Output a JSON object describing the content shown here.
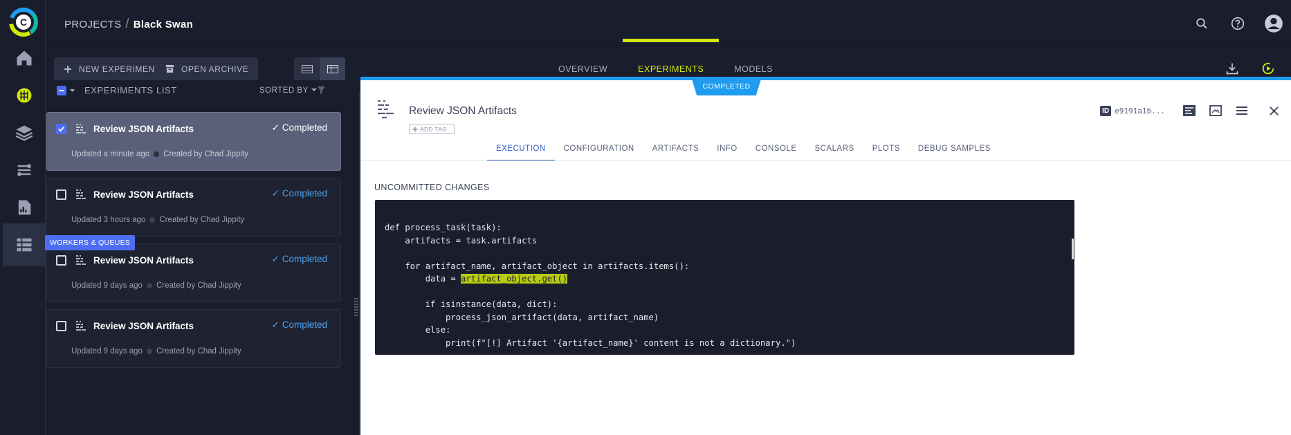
{
  "app": {
    "logo_letter": "C"
  },
  "nav": {
    "items": [
      {
        "name": "home",
        "icon": "home-icon"
      },
      {
        "name": "projects",
        "icon": "brain-icon"
      },
      {
        "name": "datasets",
        "icon": "layers-icon"
      },
      {
        "name": "pipelines",
        "icon": "pipeline-icon"
      },
      {
        "name": "reports",
        "icon": "report-icon"
      },
      {
        "name": "workers",
        "icon": "workers-icon"
      }
    ],
    "workers_tooltip": "WORKERS & QUEUES"
  },
  "breadcrumb": {
    "root": "PROJECTS",
    "separator": "/",
    "current": "Black Swan"
  },
  "toolbar": {
    "new_experiment": "NEW EXPERIMENT",
    "open_archive": "OPEN ARCHIVE",
    "tabs": [
      {
        "label": "OVERVIEW",
        "active": false
      },
      {
        "label": "EXPERIMENTS",
        "active": true
      },
      {
        "label": "MODELS",
        "active": false
      }
    ]
  },
  "list": {
    "title": "EXPERIMENTS LIST",
    "sorted_by": "SORTED BY",
    "experiments": [
      {
        "name": "Review JSON Artifacts",
        "status": "Completed",
        "updated": "Updated a minute ago",
        "created": "Created by Chad Jippity",
        "selected": true
      },
      {
        "name": "Review JSON Artifacts",
        "status": "Completed",
        "updated": "Updated 3 hours ago",
        "created": "Created by Chad Jippity",
        "selected": false
      },
      {
        "name": "Review JSON Artifacts",
        "status": "Completed",
        "updated": "Updated 9 days ago",
        "created": "Created by Chad Jippity",
        "selected": false
      },
      {
        "name": "Review JSON Artifacts",
        "status": "Completed",
        "updated": "Updated 9 days ago",
        "created": "Created by Chad Jippity",
        "selected": false
      }
    ]
  },
  "detail": {
    "status_badge": "COMPLETED",
    "title": "Review JSON Artifacts",
    "add_tag": "ADD TAG",
    "id_label": "ID",
    "id_value": "e9191a1b...",
    "tabs": [
      {
        "label": "EXECUTION",
        "active": true
      },
      {
        "label": "CONFIGURATION",
        "active": false
      },
      {
        "label": "ARTIFACTS",
        "active": false
      },
      {
        "label": "INFO",
        "active": false
      },
      {
        "label": "CONSOLE",
        "active": false
      },
      {
        "label": "SCALARS",
        "active": false
      },
      {
        "label": "PLOTS",
        "active": false
      },
      {
        "label": "DEBUG SAMPLES",
        "active": false
      }
    ],
    "section_title": "UNCOMMITTED CHANGES",
    "code_lines": [
      "def process_task(task):",
      "    artifacts = task.artifacts",
      "",
      "    for artifact_name, artifact_object in artifacts.items():",
      "        data = ",
      "",
      "        if isinstance(data, dict):",
      "            process_json_artifact(data, artifact_name)",
      "        else:",
      "            print(f\"[!] Artifact '{artifact_name}' content is not a dictionary.\")"
    ],
    "code_highlight": "artifact_object.get()"
  },
  "colors": {
    "accent_lime": "#d3e80a",
    "accent_blue": "#1f9bf0",
    "status_completed": "#4aa3f0",
    "bg_dark": "#1a1e2c"
  }
}
